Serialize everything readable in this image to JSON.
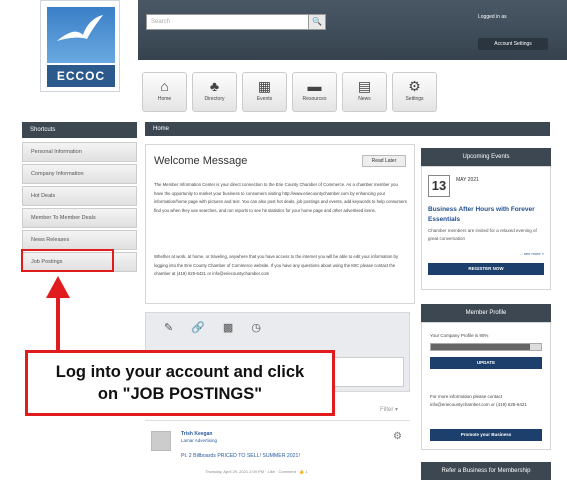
{
  "logo": {
    "text": "ECCOC"
  },
  "header": {
    "search_placeholder": "Search",
    "search_icon": "search-icon",
    "logged_in": "Logged in as",
    "account_settings": "Account Settings"
  },
  "topnav": [
    {
      "label": "Home",
      "glyph": "⌂",
      "icon": "home-icon"
    },
    {
      "label": "Directory",
      "glyph": "♣",
      "icon": "directory-icon"
    },
    {
      "label": "Events",
      "glyph": "▦",
      "icon": "events-icon"
    },
    {
      "label": "Resources",
      "glyph": "▬",
      "icon": "resources-icon"
    },
    {
      "label": "News",
      "glyph": "▤",
      "icon": "news-icon"
    },
    {
      "label": "Settings",
      "glyph": "⚙",
      "icon": "settings-icon"
    }
  ],
  "sidebar": {
    "title": "Shortcuts",
    "items": [
      "Personal Information",
      "Company Information",
      "Hot Deals",
      "Member To Member Deals",
      "News Releases",
      "Job Postings"
    ]
  },
  "main": {
    "bar_title": "Home",
    "welcome_title": "Welcome Message",
    "read_later": "Read Later",
    "p1": "The Member Information Center is your direct connection to the Erie County Chamber of Commerce. As a chamber member you have the opportunity to market your business to consumers visiting http://www.eriecountychamber.com by enhancing your information/home page with pictures and text. You can also post hot deals, job postings and events, add keywords to help consumers find you when they use searches, and run reports to see hit statistics for your home page and other advertised items.",
    "p2": "Whether at work, at home, or traveling, anywhere that you have access to the internet you will be able to edit your information by logging into the Erie County Chamber of Commerce website. If you have any questions about using the MIC please contact the chamber at (419) 625-6421 or info@eriecountychamber.com"
  },
  "composer": {
    "icons": [
      "✎",
      "🔗",
      "▩",
      "◷"
    ]
  },
  "feed": {
    "filter": "Filter ▾",
    "post": {
      "name": "Trish Keegan",
      "company": "Lamar Advertising",
      "message": "Pt. 2 Billboards PRICED TO SELL! SUMMER 2021!",
      "meta": "Thursday, April 29, 2021 2:09 PM · Like · Comment · 👍 1"
    }
  },
  "events": {
    "title": "Upcoming Events",
    "day": "13",
    "month": "MAY 2021",
    "event_title": "Business After Hours with Forever Essentials",
    "event_text": "Chamber members are invited for a relaxed evening of great conversation",
    "see_more": "... see more »",
    "register": "REGISTER NOW"
  },
  "profile": {
    "title": "Member Profile",
    "completion_text": "Your Company Profile is 90%",
    "completion_pct": 90,
    "update": "UPDATE",
    "contact": "For more information please contact info@eriecountychamber.com or (419) 625-6421",
    "promote": "Promote your Business"
  },
  "refer": {
    "title": "Refer a Business for Membership"
  },
  "callout": {
    "line1": "Log into your account and click",
    "line2": "on \"JOB POSTINGS\""
  },
  "colors": {
    "accent_red": "#e01c1c",
    "header_dark": "#3c4752",
    "button_navy": "#1d3f6b"
  }
}
